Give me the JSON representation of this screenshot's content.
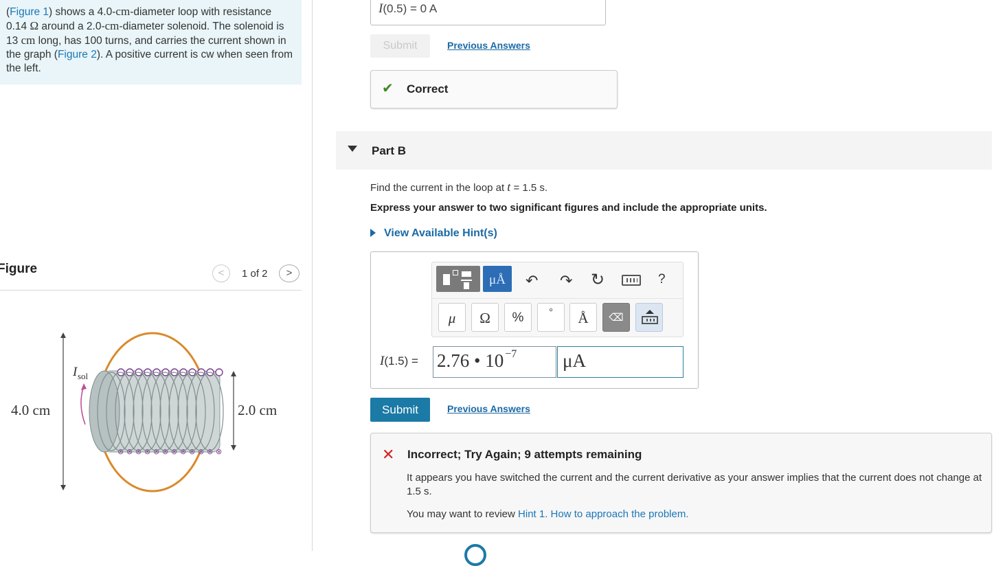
{
  "problem": {
    "figure1_link": "Figure 1",
    "segments": [
      ") shows a 4.0-",
      "-diameter loop with resistance 0.14 ",
      " around a 2.0-",
      "-diameter solenoid.  The solenoid is 13 ",
      " long, has 100 turns, and carries the current shown in the graph (",
      "). A positive current is cw when seen from the left."
    ],
    "cm": "cm",
    "ohm": "Ω",
    "figure2_link": "Figure 2"
  },
  "figure_panel": {
    "heading": "Figure",
    "prev": "<",
    "next": ">",
    "counter": "1 of 2",
    "labels": {
      "isol": "I",
      "isol_sub": "sol",
      "left_dim": "4.0 cm",
      "right_dim": "2.0 cm"
    }
  },
  "part_a": {
    "answer_label": "I",
    "answer_rest": "(0.5) =  0 A",
    "submit": "Submit",
    "previous_answers": "Previous Answers",
    "status": "Correct"
  },
  "part_b": {
    "title": "Part B",
    "question_pre": "Find the current in the loop at ",
    "question_var": "t",
    "question_post": " = 1.5 s.",
    "instruction": "Express your answer to two significant figures and include the appropriate units.",
    "hint_link": "View Available Hint(s)",
    "toolbar": {
      "units_button": "μÅ",
      "undo": "↶",
      "redo": "↷",
      "reset": "↻",
      "help": "?",
      "keys": [
        "μ",
        "Ω",
        "%",
        "°",
        "Å",
        "⌫"
      ]
    },
    "answer_label": "I",
    "answer_rest": "(1.5) = ",
    "value_main": "2.76 • 10",
    "value_exp": "−7",
    "units_value": "μA",
    "submit": "Submit",
    "previous_answers": "Previous Answers"
  },
  "feedback": {
    "title": "Incorrect; Try Again; 9 attempts remaining",
    "message": "It appears you have switched the current and the current derivative as your answer implies that the current does not change at 1.5 s.",
    "review_prefix": "You may want to review ",
    "review_link": "Hint 1. How to approach the problem.",
    "colors": {
      "incorrect": "#d12222",
      "correct": "#3a8a1f",
      "link": "#1b6aa5",
      "button": "#1b7aa6"
    }
  }
}
